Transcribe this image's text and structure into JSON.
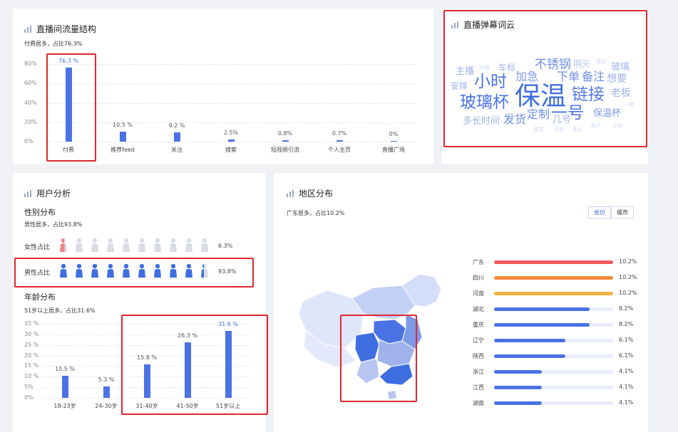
{
  "traffic": {
    "title": "直播间流量结构",
    "subtitle": "付费居多，占比76.3%",
    "yticks": [
      "80%",
      "60%",
      "40%",
      "20%",
      "0%"
    ],
    "chart_data": {
      "type": "bar",
      "categories": [
        "付费",
        "推荐feed",
        "关注",
        "搜索",
        "短视频引流",
        "个人主页",
        "直播广场"
      ],
      "values": [
        76.3,
        10.5,
        9.2,
        2.5,
        0.8,
        0.7,
        0
      ],
      "value_labels": [
        "76.3 %",
        "10.5 %",
        "9.2 %",
        "2.5%",
        "0.8%",
        "0.7%",
        "0%"
      ],
      "ylim": [
        0,
        80
      ],
      "color": "#4a72e4",
      "highlight_color": "#4a72e4"
    }
  },
  "wordcloud": {
    "title": "直播弹幕词云",
    "words": [
      "主播",
      "内容",
      "车标",
      "不锈钢",
      "明天",
      "改好",
      "玻璃",
      "安排",
      "小时",
      "加急",
      "下单",
      "备注",
      "想要",
      "玻璃杯",
      "保温",
      "链接",
      "老板",
      "一键",
      "多长时间",
      "发货",
      "定制",
      "一号",
      "保温杯",
      "几号",
      "款式",
      "开盖",
      "多久",
      "两个",
      "介绍"
    ]
  },
  "user": {
    "title": "用户分析",
    "gender_heading": "性别分布",
    "gender_subtitle": "男性居多，占比93.8%",
    "female_label": "女性占比",
    "female_pct": "6.3%",
    "female_value": 6.3,
    "male_label": "男性占比",
    "male_pct": "93.8%",
    "male_value": 93.8,
    "female_color": "#f0838a",
    "male_color": "#3f6ee0",
    "age_heading": "年龄分布",
    "age_subtitle": "51岁以上居多，占比31.6%",
    "age_yticks": [
      "35 %",
      "30 %",
      "25 %",
      "20 %",
      "15 %",
      "10 %",
      "5%",
      "0%"
    ],
    "chart_data": {
      "type": "bar",
      "categories": [
        "18-23岁",
        "24-30岁",
        "31-40岁",
        "41-50岁",
        "51岁以上"
      ],
      "values": [
        10.5,
        5.3,
        15.8,
        26.3,
        31.6
      ],
      "value_labels": [
        "10.5 %",
        "5.3 %",
        "15.8 %",
        "26.3 %",
        "31.6 %"
      ],
      "ylim": [
        0,
        35
      ],
      "color": "#4a72e4"
    }
  },
  "region": {
    "title": "地区分布",
    "subtitle": "广东居多，占比10.2%",
    "toggle_province": "省份",
    "toggle_city": "城市",
    "chart_data": {
      "type": "bar",
      "orientation": "horizontal",
      "categories": [
        "广东",
        "四川",
        "河南",
        "湖北",
        "重庆",
        "辽宁",
        "陕西",
        "浙江",
        "江西",
        "湖南"
      ],
      "values": [
        10.2,
        10.2,
        10.2,
        8.2,
        8.2,
        6.1,
        6.1,
        4.1,
        4.1,
        4.1
      ],
      "value_labels": [
        "10.2%",
        "10.2%",
        "10.2%",
        "8.2%",
        "8.2%",
        "6.1%",
        "6.1%",
        "4.1%",
        "4.1%",
        "4.1%"
      ],
      "xlim": [
        0,
        10.2
      ],
      "colors": [
        "#f25b5b",
        "#f3883a",
        "#f4b040",
        "#4a72e4",
        "#4a72e4",
        "#4a72e4",
        "#4a72e4",
        "#4a72e4",
        "#4a72e4",
        "#4a72e4"
      ]
    }
  }
}
